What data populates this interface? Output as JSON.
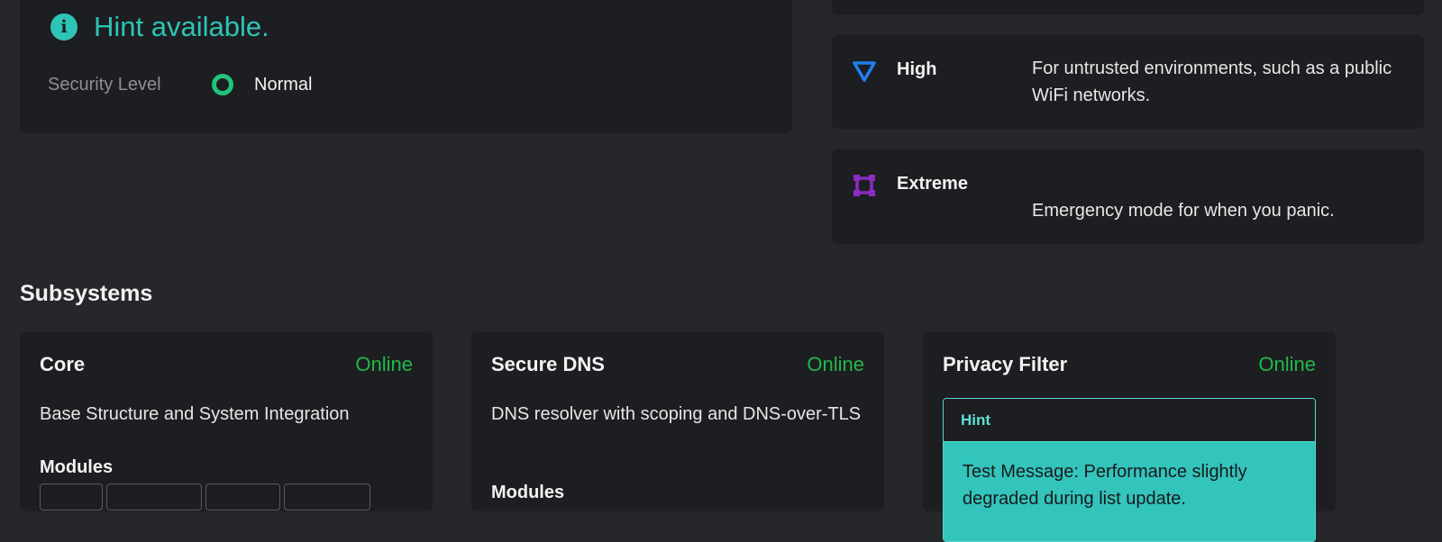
{
  "status": {
    "hint_text": "Hint available.",
    "info_icon": "info-icon",
    "info_glyph": "i",
    "security_level_label": "Security Level",
    "security_level_value": "Normal",
    "accent_color": "#2ec4b6",
    "normal_color": "#21c47a"
  },
  "levels": [
    {
      "name": "High",
      "icon": "triangle-down-icon",
      "color": "#1f7ff0",
      "description": "For untrusted environments, such as a public WiFi networks."
    },
    {
      "name": "Extreme",
      "icon": "square-frame-icon",
      "color": "#8a2bc2",
      "description": "Emergency mode for when you panic."
    }
  ],
  "subsystems_title": "Subsystems",
  "subsystems": [
    {
      "name": "Core",
      "status": "Online",
      "description": "Base Structure and System Integration",
      "modules_label": "Modules"
    },
    {
      "name": "Secure DNS",
      "status": "Online",
      "description": "DNS resolver with scoping and DNS-over-TLS",
      "modules_label": "Modules"
    },
    {
      "name": "Privacy Filter",
      "status": "Online",
      "hint_title": "Hint",
      "hint_message": "Test Message: Performance slightly degraded during list update."
    }
  ],
  "status_online_color": "#21b84a"
}
